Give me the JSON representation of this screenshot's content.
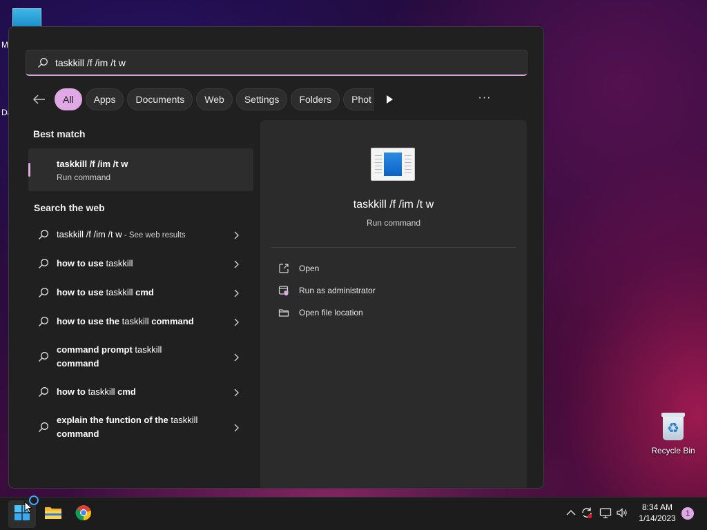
{
  "desktop": {
    "fragment_m": "M",
    "fragment_d": "Da",
    "recycle_bin_label": "Recycle Bin"
  },
  "search": {
    "query": "taskkill /f /im /t w"
  },
  "filters": {
    "chips": [
      "All",
      "Apps",
      "Documents",
      "Web",
      "Settings",
      "Folders",
      "Phot"
    ],
    "active": "All",
    "more": "···"
  },
  "best_match": {
    "heading": "Best match",
    "title": "taskkill /f /im /t w",
    "subtitle": "Run command"
  },
  "web": {
    "heading": "Search the web",
    "items": [
      {
        "bold": "taskkill /f /im /t w",
        "normal": "",
        "suffix": " - See web results"
      },
      {
        "bold": "how to use ",
        "normal": "taskkill",
        "suffix": ""
      },
      {
        "bold": "how to use ",
        "normal": "taskkill",
        "bold2": " cmd",
        "suffix": ""
      },
      {
        "bold": "how to use the ",
        "normal": "taskkill",
        "bold2": " command",
        "suffix": ""
      },
      {
        "bold": "command prompt ",
        "normal": "taskkill",
        "bold2": " command",
        "suffix": ""
      },
      {
        "bold": "how to ",
        "normal": "taskkill",
        "bold2": " cmd",
        "suffix": ""
      },
      {
        "bold": "explain the function of the ",
        "normal": "taskkill",
        "bold2": " command",
        "suffix": ""
      }
    ]
  },
  "preview": {
    "name": "taskkill /f /im /t w",
    "type": "Run command",
    "actions": [
      "Open",
      "Run as administrator",
      "Open file location"
    ]
  },
  "taskbar": {
    "time": "8:34 AM",
    "date": "1/14/2023",
    "notification_count": "1"
  },
  "colors": {
    "accent": "#e0a8e4",
    "panel": "#202020"
  }
}
